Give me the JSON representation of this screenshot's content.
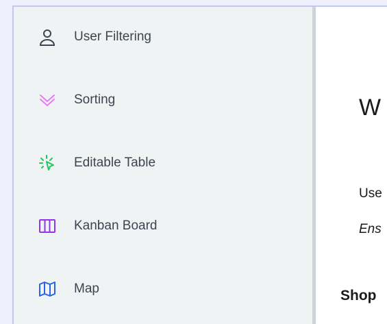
{
  "sidebar": {
    "items": [
      {
        "label": "User Filtering",
        "icon": "user-icon",
        "color": "#3d4451"
      },
      {
        "label": "Sorting",
        "icon": "chevrons-down-icon",
        "color": "#e879f9"
      },
      {
        "label": "Editable Table",
        "icon": "cursor-click-icon",
        "color": "#22c55e"
      },
      {
        "label": "Kanban Board",
        "icon": "columns-icon",
        "color": "#9333ea"
      },
      {
        "label": "Map",
        "icon": "map-icon",
        "color": "#2563eb"
      }
    ]
  },
  "main": {
    "heading": "W",
    "paragraph1": "Use",
    "paragraph2": "Ens",
    "subheading": "Shop"
  }
}
